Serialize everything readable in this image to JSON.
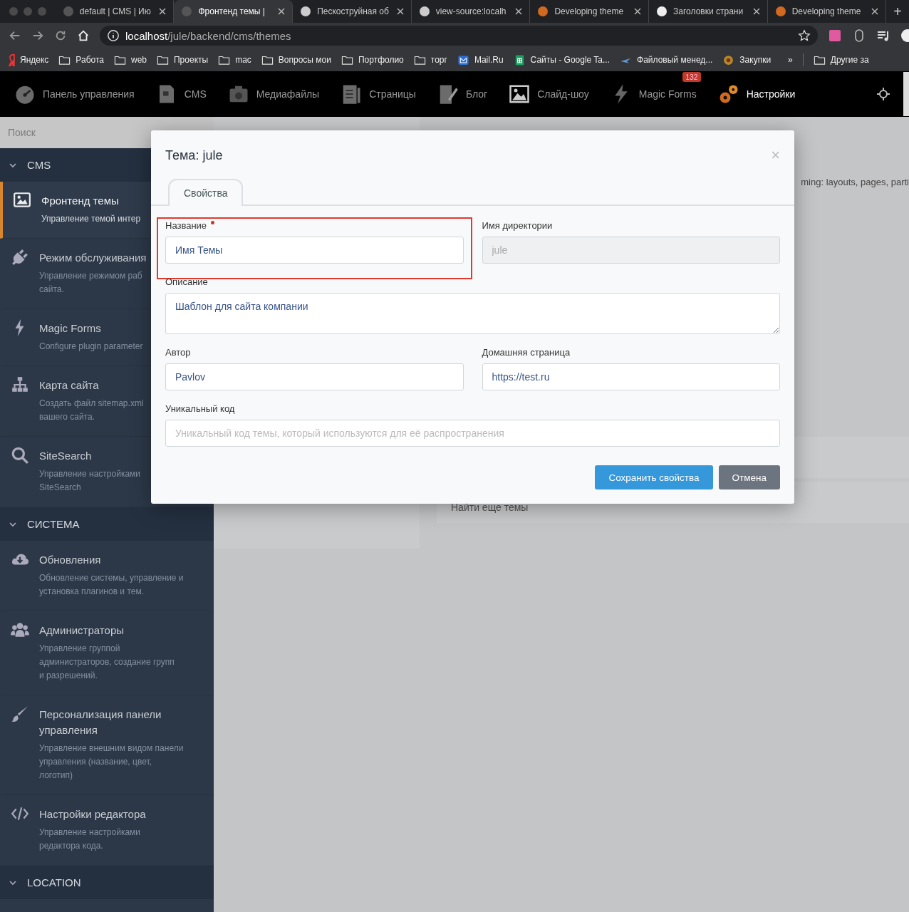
{
  "browser": {
    "tabs": [
      {
        "title": "default | CMS | Ию",
        "selected": false
      },
      {
        "title": "Фронтенд темы | ",
        "selected": true
      },
      {
        "title": "Пескоструйная об",
        "selected": false
      },
      {
        "title": "view-source:localh",
        "selected": false
      },
      {
        "title": "Developing theme",
        "selected": false
      },
      {
        "title": "Заголовки страни",
        "selected": false
      },
      {
        "title": "Developing theme",
        "selected": false
      }
    ],
    "new_tab": "+",
    "url_host": "localhost",
    "url_path": "/jule/backend/cms/themes",
    "bookmarks": [
      {
        "label": "Яндекс",
        "kind": "yandex"
      },
      {
        "label": "Работа",
        "kind": "folder"
      },
      {
        "label": "web",
        "kind": "folder"
      },
      {
        "label": "Проекты",
        "kind": "folder"
      },
      {
        "label": "mac",
        "kind": "folder"
      },
      {
        "label": "Вопросы мои",
        "kind": "folder"
      },
      {
        "label": "Портфолио",
        "kind": "folder"
      },
      {
        "label": "торг",
        "kind": "folder"
      },
      {
        "label": "Mail.Ru",
        "kind": "mail"
      },
      {
        "label": "Сайты - Google Ta...",
        "kind": "sheet"
      },
      {
        "label": "Файловый менед...",
        "kind": "plane"
      },
      {
        "label": "Закупки",
        "kind": "emblem"
      }
    ],
    "bookmarks_more": "»",
    "other_bookmarks": "Другие за"
  },
  "nav": {
    "items": [
      {
        "label": "Панель управления",
        "selected": false
      },
      {
        "label": "CMS",
        "selected": false
      },
      {
        "label": "Медиафайлы",
        "selected": false
      },
      {
        "label": "Страницы",
        "selected": false
      },
      {
        "label": "Блог",
        "selected": false
      },
      {
        "label": "Слайд-шоу",
        "selected": false
      },
      {
        "label": "Magic Forms",
        "selected": false,
        "badge": "132"
      },
      {
        "label": "Настройки",
        "selected": true
      }
    ]
  },
  "sidebar": {
    "search": {
      "placeholder": "Поиск"
    },
    "groups": [
      {
        "title": "CMS",
        "expanded": true,
        "items": [
          {
            "title": "Фронтенд темы",
            "desc": [
              "Управление темой интер"
            ],
            "selected": true
          },
          {
            "title": "Режим обслуживания",
            "desc": [
              "Управление режимом раб",
              "сайта."
            ],
            "selected": false
          },
          {
            "title": "Magic Forms",
            "desc": [
              "Configure plugin parameter"
            ],
            "selected": false
          },
          {
            "title": "Карта сайта",
            "desc": [
              "Создать файл sitemap.xml",
              "вашего сайта."
            ],
            "selected": false
          },
          {
            "title": "SiteSearch",
            "desc": [
              "Управление настройками",
              "SiteSearch"
            ],
            "selected": false
          }
        ]
      },
      {
        "title": "СИСТЕМА",
        "expanded": true,
        "items": [
          {
            "title": "Обновления",
            "desc": [
              "Обновление системы, управление и",
              "установка плагинов и тем."
            ],
            "selected": false
          },
          {
            "title": "Администраторы",
            "desc": [
              "Управление группой",
              "администраторов, создание групп",
              "и разрешений."
            ],
            "selected": false
          },
          {
            "title": "Персонализация панели управления",
            "desc": [
              "Управление внешним видом панели",
              "управления (название, цвет,",
              "логотип)"
            ],
            "selected": false
          },
          {
            "title": "Настройки редактора",
            "desc": [
              "Управление настройками",
              "редактора кода."
            ],
            "selected": false
          }
        ]
      },
      {
        "title": "LOCATION",
        "expanded": true
      }
    ]
  },
  "background": {
    "text_fragment": "ming: layouts, pages, parti",
    "link": "Найти еще темы"
  },
  "modal": {
    "title": "Тема: jule",
    "close": "×",
    "tabs": [
      {
        "label": "Свойства",
        "selected": true
      }
    ],
    "fields": [
      {
        "label": "Название",
        "required": true,
        "highlighted": true,
        "disabled": false,
        "wide": false,
        "multiline": false,
        "value": "Имя Темы"
      },
      {
        "label": "Имя директории",
        "required": false,
        "highlighted": false,
        "disabled": true,
        "wide": false,
        "multiline": false,
        "value": "jule"
      },
      {
        "label": "Описание",
        "required": false,
        "highlighted": false,
        "disabled": false,
        "wide": true,
        "multiline": true,
        "value": "Шаблон для сайта компании"
      },
      {
        "label": "Автор",
        "required": false,
        "highlighted": false,
        "disabled": false,
        "wide": false,
        "multiline": false,
        "value": "Pavlov"
      },
      {
        "label": "Домашняя страница",
        "required": false,
        "highlighted": false,
        "disabled": false,
        "wide": false,
        "multiline": false,
        "value": "https://test.ru"
      },
      {
        "label": "Уникальный код",
        "required": false,
        "highlighted": false,
        "disabled": false,
        "wide": true,
        "multiline": false,
        "placeholder": "Уникальный код темы, который используются для её распространения"
      }
    ],
    "buttons": [
      {
        "label": "Сохранить свойства",
        "kind": "primary"
      },
      {
        "label": "Отмена",
        "kind": "secondary"
      }
    ]
  }
}
